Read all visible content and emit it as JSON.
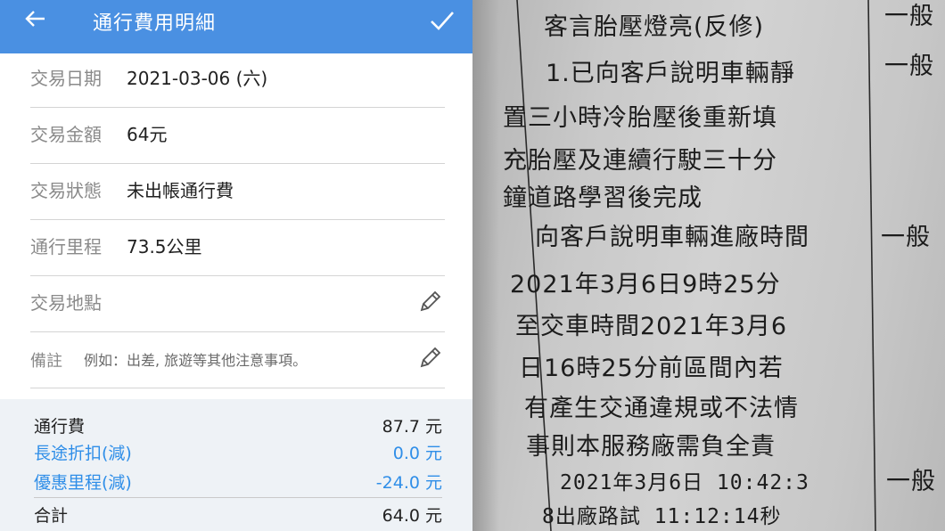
{
  "app": {
    "title": "通行費用明細"
  },
  "fields": {
    "date": {
      "label": "交易日期",
      "value": "2021-03-06 (六)"
    },
    "amount": {
      "label": "交易金額",
      "value": "64元"
    },
    "status": {
      "label": "交易狀態",
      "value": "未出帳通行費"
    },
    "mileage": {
      "label": "通行里程",
      "value": "73.5公里"
    },
    "location": {
      "label": "交易地點"
    },
    "note": {
      "label": "備註",
      "placeholder": "例如：出差, 旅遊等其他注意事項。"
    }
  },
  "summary": {
    "toll": {
      "label": "通行費",
      "value": "87.7 元"
    },
    "long_discount": {
      "label": "長途折扣(減)",
      "value": "0.0 元"
    },
    "free_mileage": {
      "label": "優惠里程(減)",
      "value": "-24.0 元"
    },
    "total": {
      "label": "合計",
      "value": "64.0 元"
    }
  },
  "document": {
    "lines": [
      "客言胎壓燈亮(反修)",
      "1.已向客戶說明車輛靜",
      "置三小時冷胎壓後重新填",
      "充胎壓及連續行駛三十分",
      "鐘道路學習後完成",
      "向客戶說明車輛進廠時間",
      "2021年3月6日9時25分",
      "至交車時間2021年3月6",
      "日16時25分前區間內若",
      "有產生交通違規或不法情",
      "事則本服務廠需負全責",
      "2021年3月6日 10:42:3",
      "8出廠路試 11:12:14秒"
    ],
    "side": [
      "一般",
      "一般",
      "一般",
      "一般"
    ]
  },
  "colors": {
    "appbar": "#4a90e2",
    "accent_blue": "#2f8ee8",
    "summary_bg": "#eef2f6"
  },
  "icons": {
    "back": "arrow-left-icon",
    "confirm": "check-icon",
    "edit": "pencil-icon"
  }
}
